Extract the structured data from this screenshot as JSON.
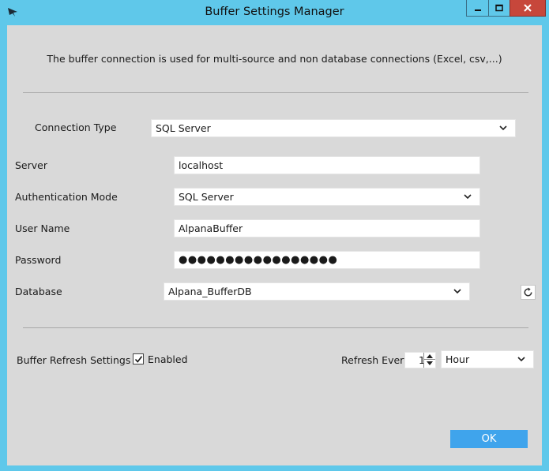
{
  "window": {
    "title": "Buffer Settings Manager",
    "colors": {
      "frame": "#5fc8ea",
      "client": "#d9d9d9",
      "close": "#c7473b",
      "accent": "#3fa4ec"
    },
    "controls": [
      "minimize-icon",
      "maximize-icon",
      "close-icon"
    ]
  },
  "info_text": "The buffer connection is used for multi-source and non database connections (Excel, csv,...)",
  "connection_type": {
    "label": "Connection Type",
    "value": "SQL Server"
  },
  "server": {
    "label": "Server",
    "value": "localhost"
  },
  "authentication": {
    "label": "Authentication Mode",
    "value": "SQL Server"
  },
  "user_name": {
    "label": "User Name",
    "value": "AlpanaBuffer"
  },
  "password": {
    "label": "Password",
    "masked_value": "●●●●●●●●●●●●●●●●●"
  },
  "database": {
    "label": "Database",
    "value": "Alpana_BufferDB",
    "refresh_icon": "refresh-icon"
  },
  "buffer_refresh": {
    "label": "Buffer Refresh Settings",
    "enabled_label": "Enabled",
    "enabled": true,
    "refresh_every_label": "Refresh Every",
    "interval_value": "1",
    "interval_unit": "Hour"
  },
  "ok_button": {
    "label": "OK"
  }
}
